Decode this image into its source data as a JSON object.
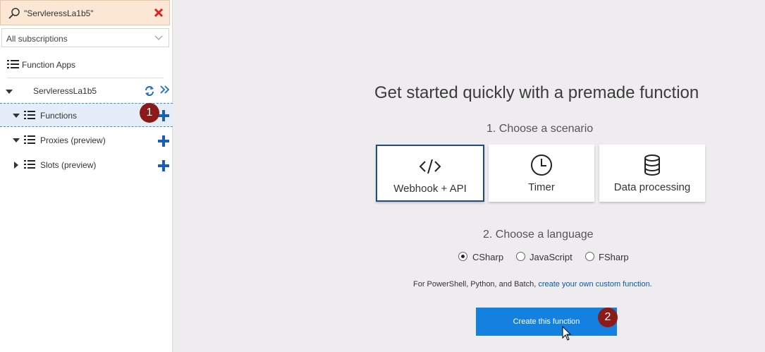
{
  "search": {
    "value": "\"ServleressLa1b5\""
  },
  "subscriptions": {
    "selected": "All subscriptions"
  },
  "nav": {
    "function_apps_label": "Function Apps",
    "app_name": "ServleressLa1b5",
    "items": [
      {
        "label": "Functions"
      },
      {
        "label": "Proxies (preview)"
      },
      {
        "label": "Slots (preview)"
      }
    ]
  },
  "badges": {
    "one": "1",
    "two": "2"
  },
  "main": {
    "title": "Get started quickly with a premade function",
    "step1": "1. Choose a scenario",
    "scenarios": [
      {
        "label": "Webhook + API",
        "icon": "code-icon"
      },
      {
        "label": "Timer",
        "icon": "clock-icon"
      },
      {
        "label": "Data processing",
        "icon": "database-icon"
      }
    ],
    "step2": "2. Choose a language",
    "languages": [
      {
        "label": "CSharp",
        "selected": true
      },
      {
        "label": "JavaScript",
        "selected": false
      },
      {
        "label": "FSharp",
        "selected": false
      }
    ],
    "custom_prefix": "For PowerShell, Python, and Batch, ",
    "custom_link": "create your own custom function.",
    "create_button": "Create this function"
  },
  "colors": {
    "accent": "#1480e0",
    "badge": "#8b1a1a",
    "search_bg": "#fce6d4",
    "selected_border": "#1f4e79"
  }
}
